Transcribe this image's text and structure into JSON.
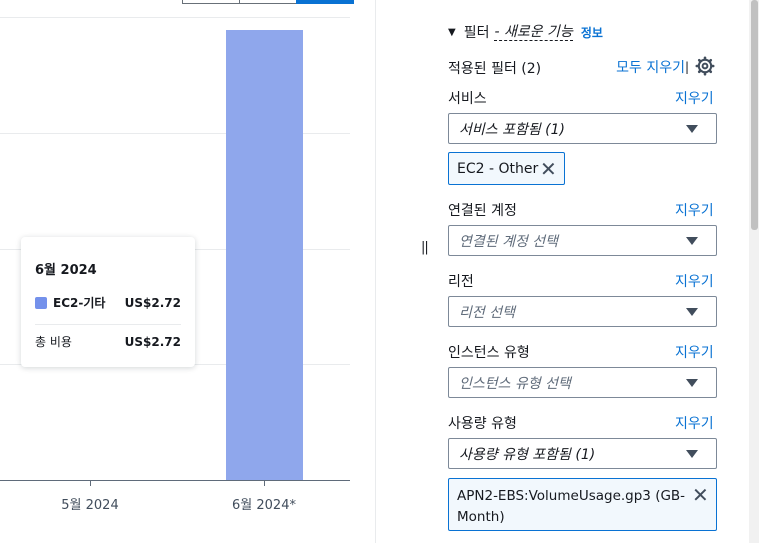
{
  "chart_data": {
    "type": "bar",
    "categories": [
      "5월 2024",
      "6월 2024*"
    ],
    "series": [
      {
        "name": "EC2-기타",
        "values": [
          0,
          2.72
        ]
      }
    ],
    "ylim": [
      0,
      2.8
    ],
    "grid": true
  },
  "tooltip": {
    "title": "6월 2024",
    "series_label": "EC2-기타",
    "series_value": "US$2.72",
    "total_label": "총 비용",
    "total_value": "US$2.72",
    "swatch_color": "#7491eb"
  },
  "splitter": {
    "handle": "||"
  },
  "filters": {
    "header": "필터",
    "header_new": "- 새로운 기능",
    "header_info": "정보",
    "applied": "적용된 필터 (2)",
    "clear_all": "모두 지우기",
    "pipe": "|",
    "clear_label": "지우기",
    "service": {
      "label": "서비스",
      "select": "서비스 포함됨 (1)",
      "token": "EC2 - Other"
    },
    "linked_account": {
      "label": "연결된 계정",
      "select": "연결된 계정 선택"
    },
    "region": {
      "label": "리전",
      "select": "리전 선택"
    },
    "instance_type": {
      "label": "인스턴스 유형",
      "select": "인스턴스 유형 선택"
    },
    "usage_type": {
      "label": "사용량 유형",
      "select": "사용량 유형 포함됨 (1)",
      "token_line1": "APN2-EBS:VolumeUsage.gp3 (GB-",
      "token_line2": "Month)"
    }
  },
  "colors": {
    "accent": "#0972d3",
    "bar": "#8fa7ec"
  }
}
